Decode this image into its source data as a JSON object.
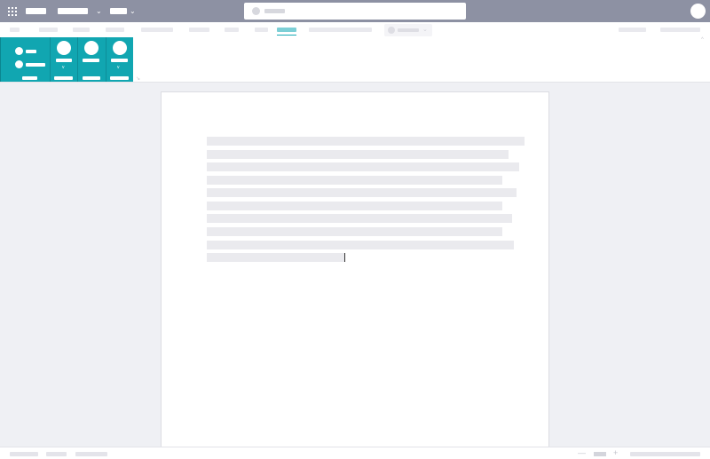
{
  "titlebar": {
    "background": "#8d91a3",
    "icons": {
      "app_launcher": "waffle-grid-icon",
      "search": "search-icon",
      "profile": "avatar-icon",
      "chevron": "chevron-down-icon"
    },
    "chevron_glyph": "⌄"
  },
  "ribbon": {
    "accent": "#11a6b1",
    "active_tab_color": "#7ccfd6",
    "editing_chevron_glyph": "⌄",
    "group_launcher_glyph": "↘",
    "collapse_glyph": "^"
  },
  "statusbar": {
    "zoom_out_glyph": "—",
    "zoom_in_glyph": "+"
  },
  "document": {
    "page_color": "#ffffff",
    "line_count": 10
  }
}
